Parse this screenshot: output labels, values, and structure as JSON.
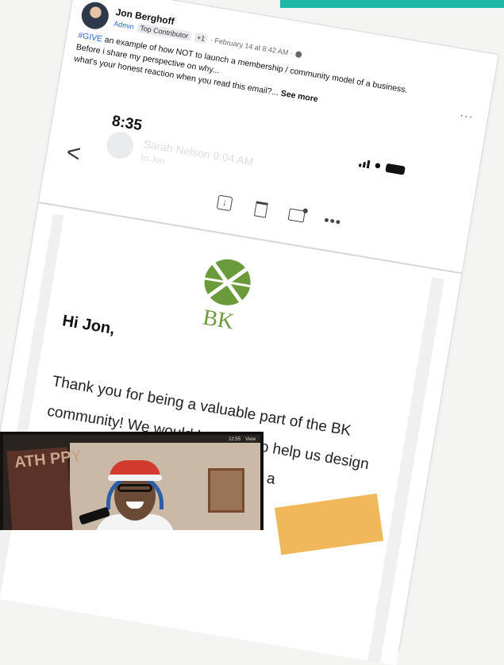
{
  "post": {
    "author": "Jon Berghoff",
    "badge_admin": "Admin",
    "badge_contributor": "Top Contributor",
    "badge_more": "+1",
    "meta": "· February 14 at 8:42 AM ·",
    "hashtag": "#GIVE",
    "text_line1": " an example of how NOT to launch a membership / community model of a business.",
    "text_line2": "Before i share my perspective on why...",
    "text_line3": "what's your honest reaction when you read this email?... ",
    "see_more": "See more",
    "more_dots": "···"
  },
  "phone": {
    "time": "8:35",
    "sender_name": "Sarah Nelson",
    "sender_time": "9:04 AM",
    "sender_to": "to Jon",
    "back_glyph": "<",
    "more_glyph": "•••",
    "logo_text": "BK",
    "greeting": "Hi Jon,",
    "body": "Thank you for being a valuable part of the BK community! We would love you to help us design a new experience... we're making a"
  },
  "video": {
    "clock": "12:55",
    "view_label": "View",
    "art_text": "ATH PPY"
  },
  "colors": {
    "accent_teal": "#1fb8a8",
    "link_blue": "#2a6ad6",
    "bk_green": "#6a9a3a"
  }
}
